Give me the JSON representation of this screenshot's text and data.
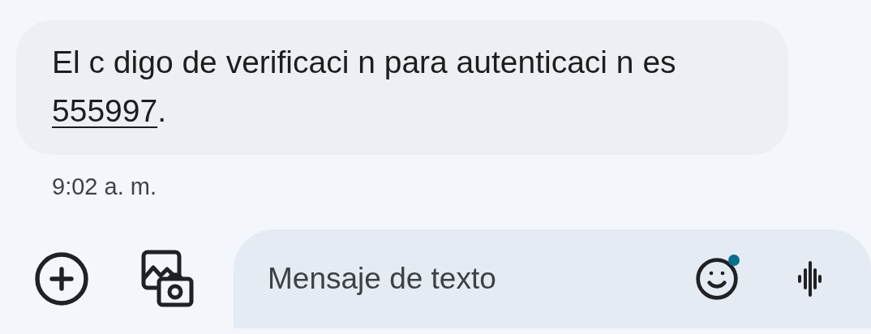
{
  "message": {
    "text": "El c digo de verificaci n para autenticaci n es",
    "code": "555997",
    "suffix": ".",
    "time": "9:02 a. m."
  },
  "composer": {
    "placeholder": "Mensaje de texto",
    "emoji_badge": true
  }
}
